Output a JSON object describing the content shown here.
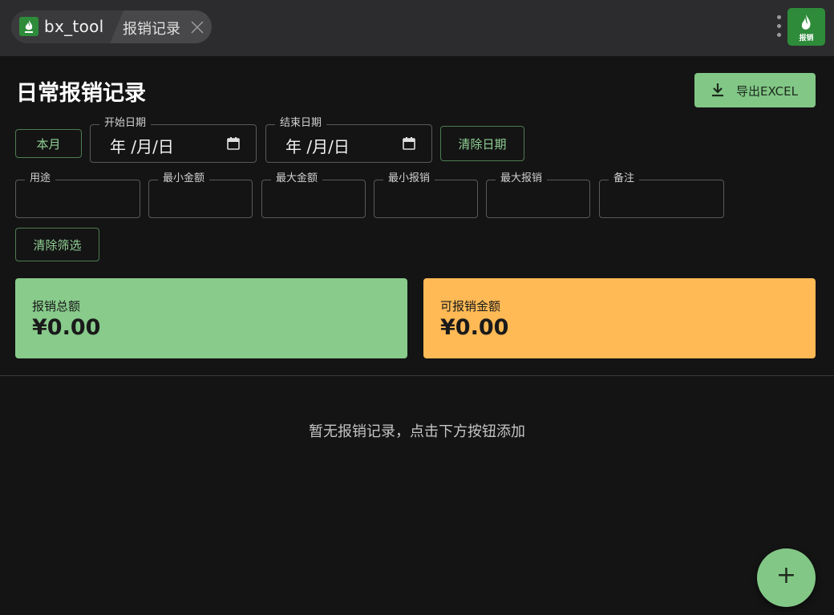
{
  "topbar": {
    "app_name": "bx_tool",
    "active_tab": "报销记录",
    "logo_text": "报销"
  },
  "header": {
    "title": "日常报销记录",
    "export_label": "导出EXCEL"
  },
  "date_filter": {
    "this_month_label": "本月",
    "start_label": "开始日期",
    "start_value": "年 /月/日",
    "end_label": "结束日期",
    "end_value": "年 /月/日",
    "clear_dates_label": "清除日期"
  },
  "filters": {
    "purpose_label": "用途",
    "min_amount_label": "最小金额",
    "max_amount_label": "最大金额",
    "min_reimburse_label": "最小报销",
    "max_reimburse_label": "最大报销",
    "remark_label": "备注",
    "clear_filters_label": "清除筛选"
  },
  "summary": {
    "total_label": "报销总额",
    "total_value": "¥0.00",
    "available_label": "可报销金额",
    "available_value": "¥0.00"
  },
  "empty_message": "暂无报销记录，点击下方按钮添加",
  "fab_label": "+",
  "colors": {
    "accent_green": "#82c786",
    "accent_orange": "#ffb955",
    "background": "#141414",
    "topbar": "#2c2c2e"
  }
}
